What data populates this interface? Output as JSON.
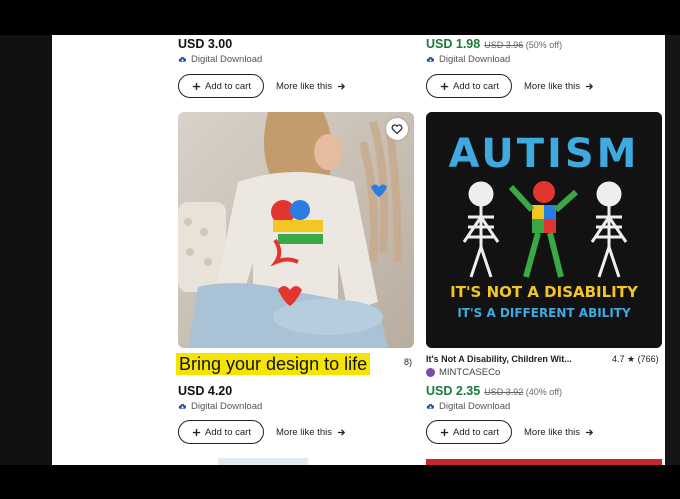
{
  "listings": [
    {
      "price": "USD 3.00",
      "download_label": "Digital Download",
      "add_to_cart": "Add to cart",
      "more_like_this": "More like this"
    },
    {
      "price": "USD 1.98",
      "original_price": "USD 3.96",
      "discount": "(50% off)",
      "download_label": "Digital Download",
      "add_to_cart": "Add to cart",
      "more_like_this": "More like this"
    },
    {
      "caption": "Bring your design to life",
      "rating_fragment": "8)",
      "price": "USD 4.20",
      "download_label": "Digital Download",
      "add_to_cart": "Add to cart",
      "more_like_this": "More like this"
    },
    {
      "title": "It's Not A Disability, Children Wit...",
      "rating": "4.7 ★ (766)",
      "seller": "MINTCASECo",
      "price": "USD 2.35",
      "original_price": "USD 3.92",
      "discount": "(40% off)",
      "download_label": "Digital Download",
      "add_to_cart": "Add to cart",
      "more_like_this": "More like this",
      "design_text": {
        "headline": "AUTISM",
        "line1": "IT'S NOT A DISABILITY",
        "line2": "IT'S A DIFFERENT ABILITY"
      }
    }
  ],
  "icons": {
    "cart": "cart-plus-icon",
    "arrow": "arrow-right-icon",
    "download": "cloud-download-icon",
    "favorite": "heart-icon"
  },
  "colors": {
    "sale_price": "#1a7a3b",
    "caption_bg": "#f5e400",
    "page_bg": "#ffffff"
  }
}
